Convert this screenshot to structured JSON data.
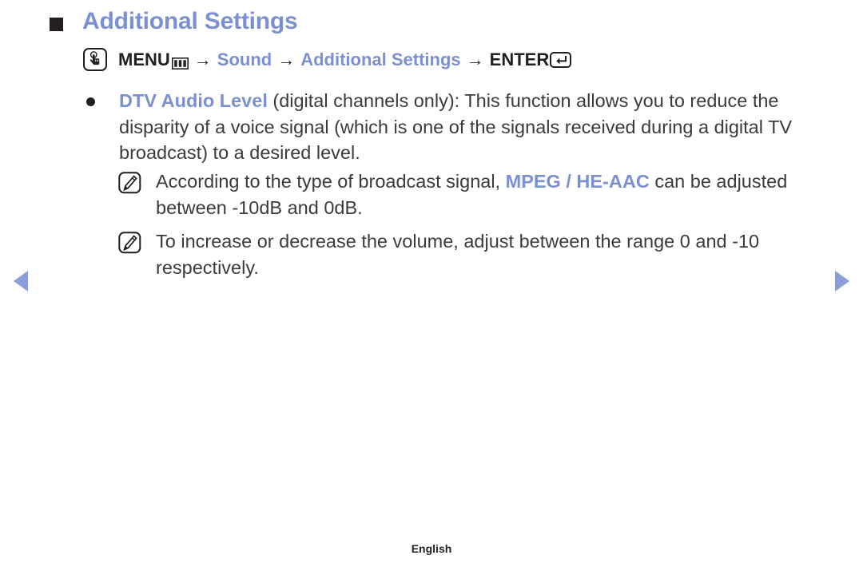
{
  "page": {
    "heading": "Additional Settings",
    "footer_language": "English"
  },
  "menu_path": {
    "remote_icon": "remote-button-press-icon",
    "menu_label": "MENU",
    "menu_glyph": "menu-grid-icon",
    "arrow": "→",
    "sound_label": "Sound",
    "additional_settings_label": "Additional Settings",
    "enter_label": "ENTER",
    "enter_glyph": "enter-key-icon"
  },
  "bullets": [
    {
      "icon": "bullet-dot",
      "title": "DTV Audio Level",
      "body": " (digital channels only): This function allows you to reduce the disparity of a voice signal (which is one of the signals received during a digital TV broadcast) to a desired level."
    }
  ],
  "notes": [
    {
      "icon": "note-pencil-icon",
      "text_before": "According to the type of broadcast signal, ",
      "highlight": "MPEG / HE-AAC",
      "text_after": " can be adjusted between -10dB and 0dB."
    },
    {
      "icon": "note-pencil-icon",
      "text_before": "To increase or decrease the volume, adjust between the range 0 and -10 respectively.",
      "highlight": "",
      "text_after": ""
    }
  ],
  "navigation": {
    "prev_label": "previous-page-arrow",
    "next_label": "next-page-arrow"
  },
  "colors": {
    "accent_blue": "#7b90d2",
    "arrow_blue": "#8b9cd8",
    "text_dark": "#3b3b3c"
  }
}
